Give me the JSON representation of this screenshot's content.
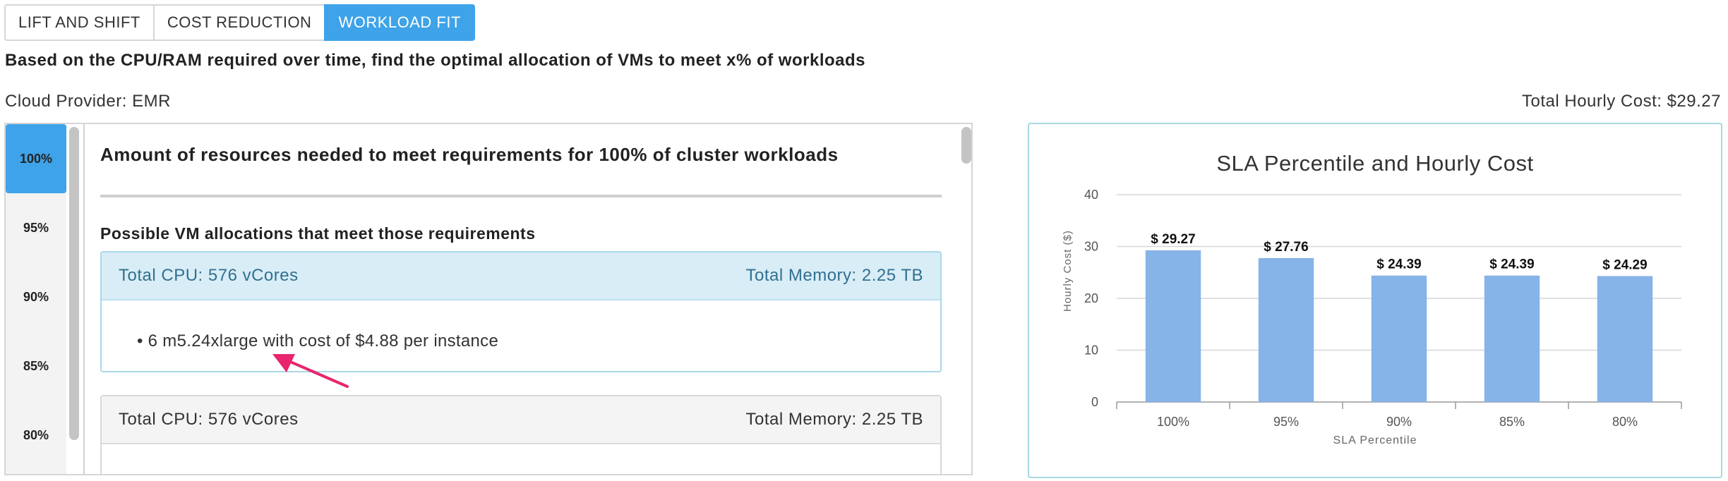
{
  "tabs": [
    {
      "label": "LIFT AND SHIFT",
      "active": false
    },
    {
      "label": "COST REDUCTION",
      "active": false
    },
    {
      "label": "WORKLOAD FIT",
      "active": true
    }
  ],
  "description": "Based on the CPU/RAM required over time, find the optimal allocation of VMs to meet x% of workloads",
  "provider_text": "Cloud Provider: EMR",
  "total_cost_text": "Total Hourly Cost: $29.27",
  "percentiles": [
    "100%",
    "95%",
    "90%",
    "85%",
    "80%"
  ],
  "selected_percentile": "100%",
  "main": {
    "title": "Amount of resources needed to meet requirements for 100% of cluster workloads",
    "subtitle": "Possible VM allocations that meet those requirements"
  },
  "allocations": [
    {
      "cpu": "Total CPU: 576 vCores",
      "memory": "Total Memory: 2.25 TB",
      "items": [
        "6 m5.24xlarge with cost of $4.88 per instance"
      ]
    },
    {
      "cpu": "Total CPU: 576 vCores",
      "memory": "Total Memory: 2.25 TB",
      "items": []
    }
  ],
  "colors": {
    "accent": "#3ea3e8",
    "bar": "#86b3e8",
    "arrow": "#e8256e"
  },
  "chart_data": {
    "type": "bar",
    "title": "SLA Percentile and Hourly Cost",
    "xlabel": "SLA Percentile",
    "ylabel": "Hourly Cost ($)",
    "categories": [
      "100%",
      "95%",
      "90%",
      "85%",
      "80%"
    ],
    "values": [
      29.27,
      27.76,
      24.39,
      24.39,
      24.29
    ],
    "data_labels": [
      "$ 29.27",
      "$ 27.76",
      "$ 24.39",
      "$ 24.39",
      "$ 24.29"
    ],
    "yticks": [
      "0",
      "10",
      "20",
      "30",
      "40"
    ],
    "ylim": [
      0,
      40
    ],
    "grid": true,
    "legend": "none"
  }
}
